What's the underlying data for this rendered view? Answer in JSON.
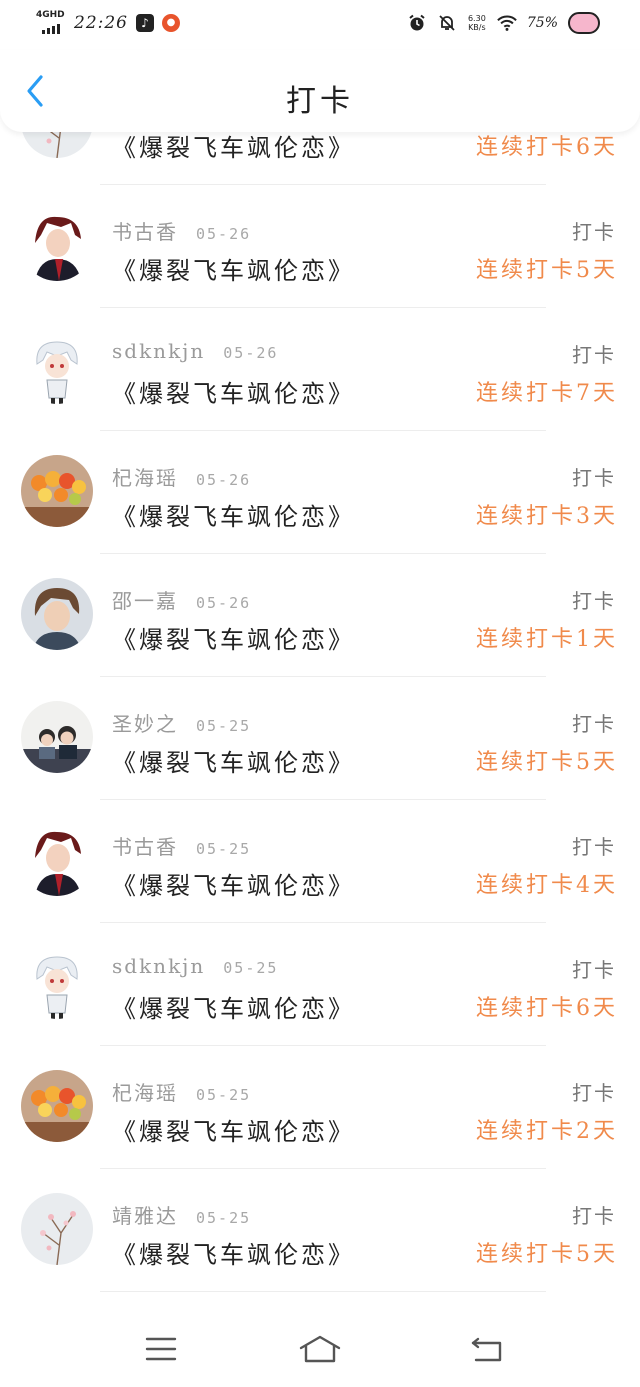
{
  "status_bar": {
    "network": "4GHD",
    "time": "22:26",
    "speed_top": "6.30",
    "speed_unit": "KB/s",
    "battery": "75%",
    "icons": [
      "music-app-icon",
      "game-app-icon",
      "alarm-icon",
      "mute-icon",
      "wifi-icon",
      "pig-icon"
    ]
  },
  "header": {
    "title": "打卡",
    "back_icon": "chevron-left-icon"
  },
  "colors": {
    "accent_blue": "#2a9df4",
    "streak_orange": "#f08a4b",
    "muted_gray": "#9a9a9a"
  },
  "checkins": [
    {
      "user": "",
      "date": "",
      "book": "《爆裂飞车飒伦恋》",
      "tag": "",
      "streak": "连续打卡6天",
      "avatar": "blossom"
    },
    {
      "user": "书古香",
      "date": "05-26",
      "book": "《爆裂飞车飒伦恋》",
      "tag": "打卡",
      "streak": "连续打卡5天",
      "avatar": "redhair"
    },
    {
      "user": "sdknkjn",
      "date": "05-26",
      "book": "《爆裂飞车飒伦恋》",
      "tag": "打卡",
      "streak": "连续打卡7天",
      "avatar": "whitehair"
    },
    {
      "user": "杞海瑶",
      "date": "05-26",
      "book": "《爆裂飞车飒伦恋》",
      "tag": "打卡",
      "streak": "连续打卡3天",
      "avatar": "fruit"
    },
    {
      "user": "邵一嘉",
      "date": "05-26",
      "book": "《爆裂飞车飒伦恋》",
      "tag": "打卡",
      "streak": "连续打卡1天",
      "avatar": "man"
    },
    {
      "user": "圣妙之",
      "date": "05-25",
      "book": "《爆裂飞车飒伦恋》",
      "tag": "打卡",
      "streak": "连续打卡5天",
      "avatar": "kids"
    },
    {
      "user": "书古香",
      "date": "05-25",
      "book": "《爆裂飞车飒伦恋》",
      "tag": "打卡",
      "streak": "连续打卡4天",
      "avatar": "redhair"
    },
    {
      "user": "sdknkjn",
      "date": "05-25",
      "book": "《爆裂飞车飒伦恋》",
      "tag": "打卡",
      "streak": "连续打卡6天",
      "avatar": "whitehair"
    },
    {
      "user": "杞海瑶",
      "date": "05-25",
      "book": "《爆裂飞车飒伦恋》",
      "tag": "打卡",
      "streak": "连续打卡2天",
      "avatar": "fruit"
    },
    {
      "user": "靖雅达",
      "date": "05-25",
      "book": "《爆裂飞车飒伦恋》",
      "tag": "打卡",
      "streak": "连续打卡5天",
      "avatar": "blossom"
    }
  ],
  "bottom_nav": {
    "icons": [
      "menu-icon",
      "home-icon",
      "back-icon"
    ]
  }
}
